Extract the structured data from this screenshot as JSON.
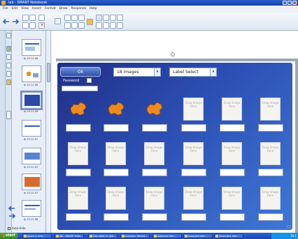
{
  "window": {
    "title": "lab - SMART Notebook"
  },
  "menu": [
    "File",
    "Edit",
    "View",
    "Insert",
    "Format",
    "Draw",
    "Response",
    "Help"
  ],
  "sorter": {
    "thumbs": [
      {
        "label": "fp 23.11.06"
      },
      {
        "label": "fp 23.11.06"
      },
      {
        "label": "fp 23.11.06"
      },
      {
        "label": "fp 23.11.07"
      },
      {
        "label": "fp 23.11.07"
      },
      {
        "label": "fp 23.11.07"
      },
      {
        "label": "fp 23.11.08"
      }
    ],
    "auto_hide": "Auto-hide"
  },
  "panel": {
    "ok_label": "Ok",
    "password_label": "Password",
    "image_count": "18 images",
    "label_select": "Label Select",
    "placeholder_text": "Drag Image Here",
    "corner_badge": "1/1"
  },
  "taskbar": {
    "start": "start",
    "tasks": [
      "ppsck e ncm...",
      "lab - SMART Note...",
      "Use radio m rgib...",
      "convaex- Micros...",
      "www.shd Sah...",
      "www.ob4 Sah...",
      "www.nbs1 Sah..."
    ],
    "clock": "16:1"
  },
  "colors": {
    "panel_dark": "#1f2f86",
    "panel_light": "#3f78d6",
    "accent_orange": "#f08a1e"
  }
}
